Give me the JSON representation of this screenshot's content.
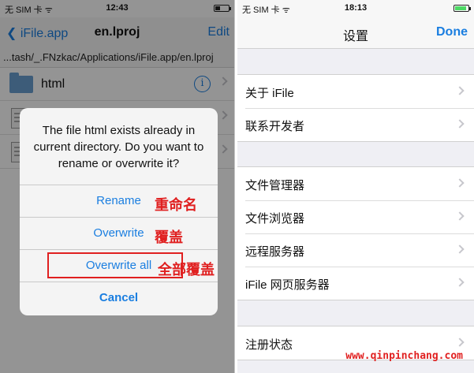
{
  "left_status": {
    "carrier": "无 SIM 卡 ᯤ",
    "time": "12:43",
    "battery_level": 0.35
  },
  "left_nav": {
    "back_label": "❮ iFile.app",
    "title": "en.lproj",
    "edit_label": "Edit"
  },
  "path_text": "...tash/_.FNzkac/Applications/iFile.app/en.lproj",
  "files": [
    {
      "name": "html",
      "icon": "folder-icon"
    }
  ],
  "alert": {
    "message": "The file html exists already in current directory. Do you want to rename or overwrite it?",
    "buttons": [
      {
        "label": "Rename",
        "note": "重命名"
      },
      {
        "label": "Overwrite",
        "note": "覆盖"
      },
      {
        "label": "Overwrite all",
        "note": "全部覆盖"
      },
      {
        "label": "Cancel"
      }
    ]
  },
  "right_status": {
    "carrier": "无 SIM 卡 ᯤ",
    "time": "18:13",
    "battery_level": 0.85
  },
  "right_nav": {
    "title": "设置",
    "done_label": "Done"
  },
  "settings_groups": [
    [
      "关于 iFile",
      "联系开发者"
    ],
    [
      "文件管理器",
      "文件浏览器",
      "远程服务器",
      "iFile 网页服务器"
    ],
    [
      "注册状态"
    ]
  ],
  "watermark": "www.qinpinchang.com",
  "colors": {
    "accent": "#1a7ee0",
    "annotation": "#e02020",
    "battery_green": "#4cd964"
  }
}
